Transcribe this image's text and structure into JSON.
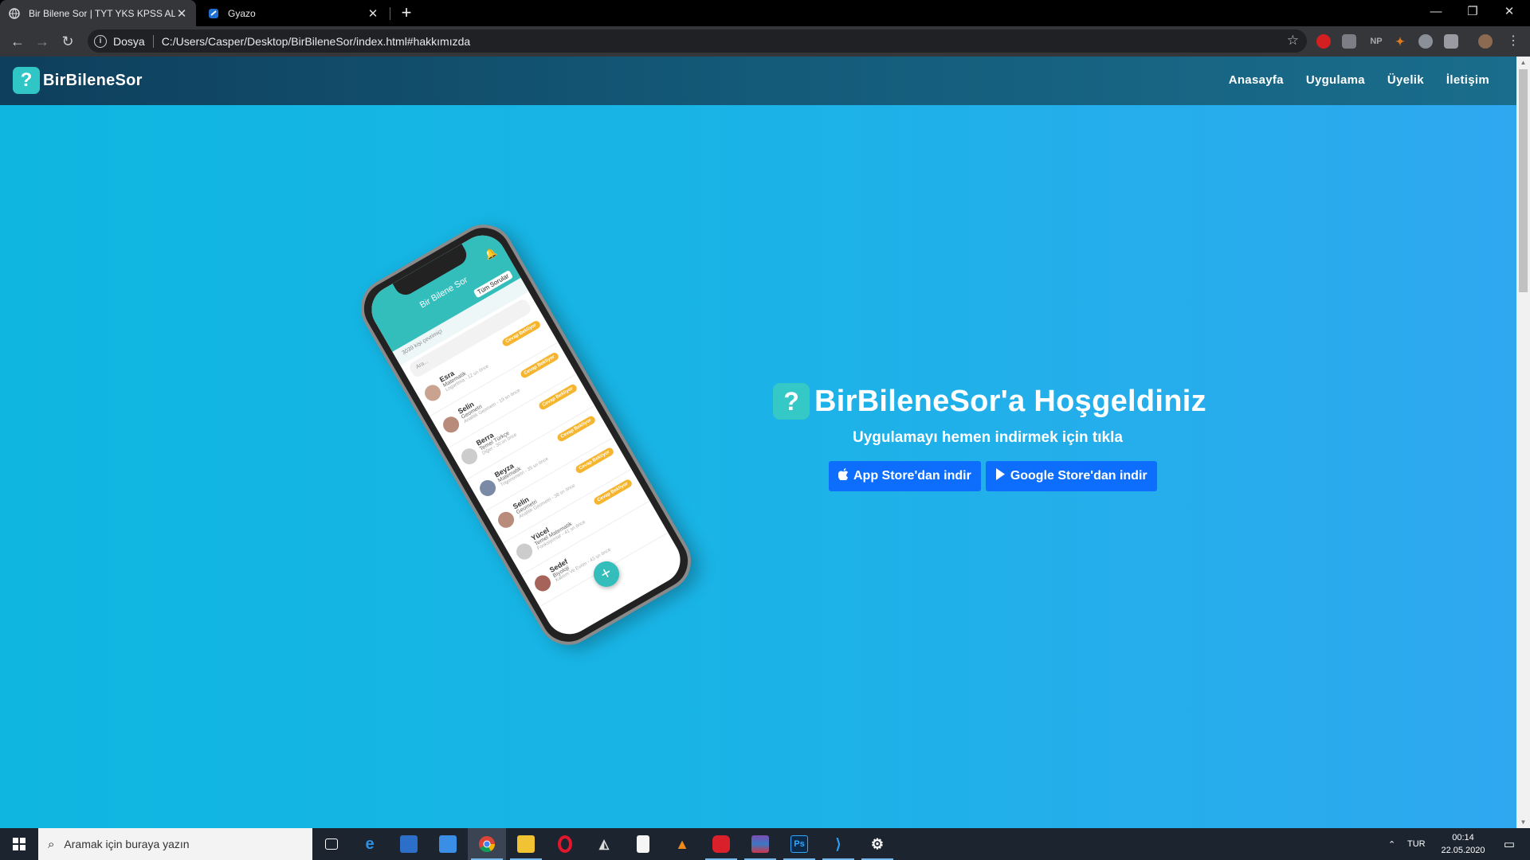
{
  "browser": {
    "tabs": [
      {
        "title": "Bir Bilene Sor | TYT YKS KPSS ALES",
        "active": true
      },
      {
        "title": "Gyazo",
        "active": false
      }
    ],
    "address": {
      "scheme_label": "Dosya",
      "url": "C:/Users/Casper/Desktop/BirBileneSor/index.html#hakkımızda"
    },
    "extensions": [
      "NP"
    ]
  },
  "site": {
    "brand": "BirBileneSor",
    "nav": [
      "Anasayfa",
      "Uygulama",
      "Üyelik",
      "İletişim"
    ],
    "hero": {
      "title": "BirBileneSor'a Hoşgeldiniz",
      "subtitle": "Uygulamayı hemen indirmek için tıkla",
      "app_store_label": "App Store'dan indir",
      "google_store_label": "Google Store'dan indir"
    },
    "colors": {
      "nav_bg": "#0e3f5c",
      "hero_bg": "#19b4e6",
      "button": "#0d6efd",
      "brand_teal": "#33bdbb"
    }
  },
  "phone_app": {
    "title": "Bir Bilene Sor",
    "filter": "Tüm Sorular",
    "online": "3039 kişi çevrimiçi",
    "search_placeholder": "Ara...",
    "badge": "Cevap Bekliyor",
    "questions": [
      {
        "name": "Esra",
        "subject": "Matematik",
        "meta": "Logaritma - 12 sn önce"
      },
      {
        "name": "Selin",
        "subject": "Geometri",
        "meta": "Analitik Geometri - 19 sn önce"
      },
      {
        "name": "Berra",
        "subject": "Temel Türkçe",
        "meta": "Diğer - 30 sn önce"
      },
      {
        "name": "Beyza",
        "subject": "Matematik",
        "meta": "Trigonometri - 35 sn önce"
      },
      {
        "name": "Selin",
        "subject": "Geometri",
        "meta": "Analitik Geometri - 38 sn önce"
      },
      {
        "name": "Yücel",
        "subject": "Temel Matematik",
        "meta": "Fonksiyonlar - 41 sn önce"
      },
      {
        "name": "Sedef",
        "subject": "Biyoloji",
        "meta": "Kalıtım Ve Evrim - 43 sn önce"
      }
    ]
  },
  "taskbar": {
    "search_placeholder": "Aramak için buraya yazın",
    "language": "TUR",
    "time": "00:14",
    "date": "22.05.2020"
  }
}
